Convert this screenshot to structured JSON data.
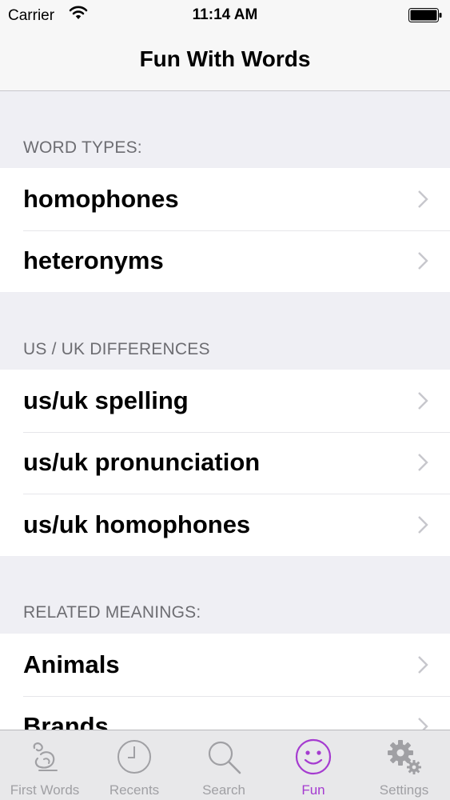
{
  "status_bar": {
    "carrier": "Carrier",
    "time": "11:14 AM"
  },
  "nav": {
    "title": "Fun With Words"
  },
  "sections": [
    {
      "header": "WORD TYPES:",
      "items": [
        "homophones",
        "heteronyms"
      ]
    },
    {
      "header": "US / UK DIFFERENCES",
      "items": [
        "us/uk spelling",
        "us/uk pronunciation",
        "us/uk homophones"
      ]
    },
    {
      "header": "RELATED MEANINGS:",
      "items": [
        "Animals",
        "Brands"
      ]
    }
  ],
  "tabs": [
    {
      "label": "First Words",
      "icon": "first-words-icon"
    },
    {
      "label": "Recents",
      "icon": "clock-icon"
    },
    {
      "label": "Search",
      "icon": "search-icon"
    },
    {
      "label": "Fun",
      "icon": "smiley-icon"
    },
    {
      "label": "Settings",
      "icon": "gear-icon"
    }
  ],
  "colors": {
    "accent": "#a53bd0",
    "tab_inactive": "#a0a0a4",
    "background": "#efeff4"
  }
}
